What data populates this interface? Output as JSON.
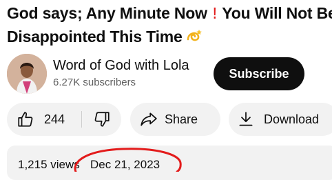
{
  "video": {
    "title_line1": "God says; Any Minute Now",
    "title_excl": "!",
    "title_line1_end": "You Will Not Be",
    "title_line2": "Disappointed This Time"
  },
  "channel": {
    "name": "Word of God with Lola",
    "subscribers": "6.27K subscribers",
    "subscribe_label": "Subscribe"
  },
  "actions": {
    "like_count": "244",
    "share_label": "Share",
    "download_label": "Download"
  },
  "description": {
    "views": "1,215 views",
    "date": "Dec 21, 2023"
  },
  "colors": {
    "annotation_circle": "#e31b1b",
    "exclamation": "#e21c1c"
  }
}
